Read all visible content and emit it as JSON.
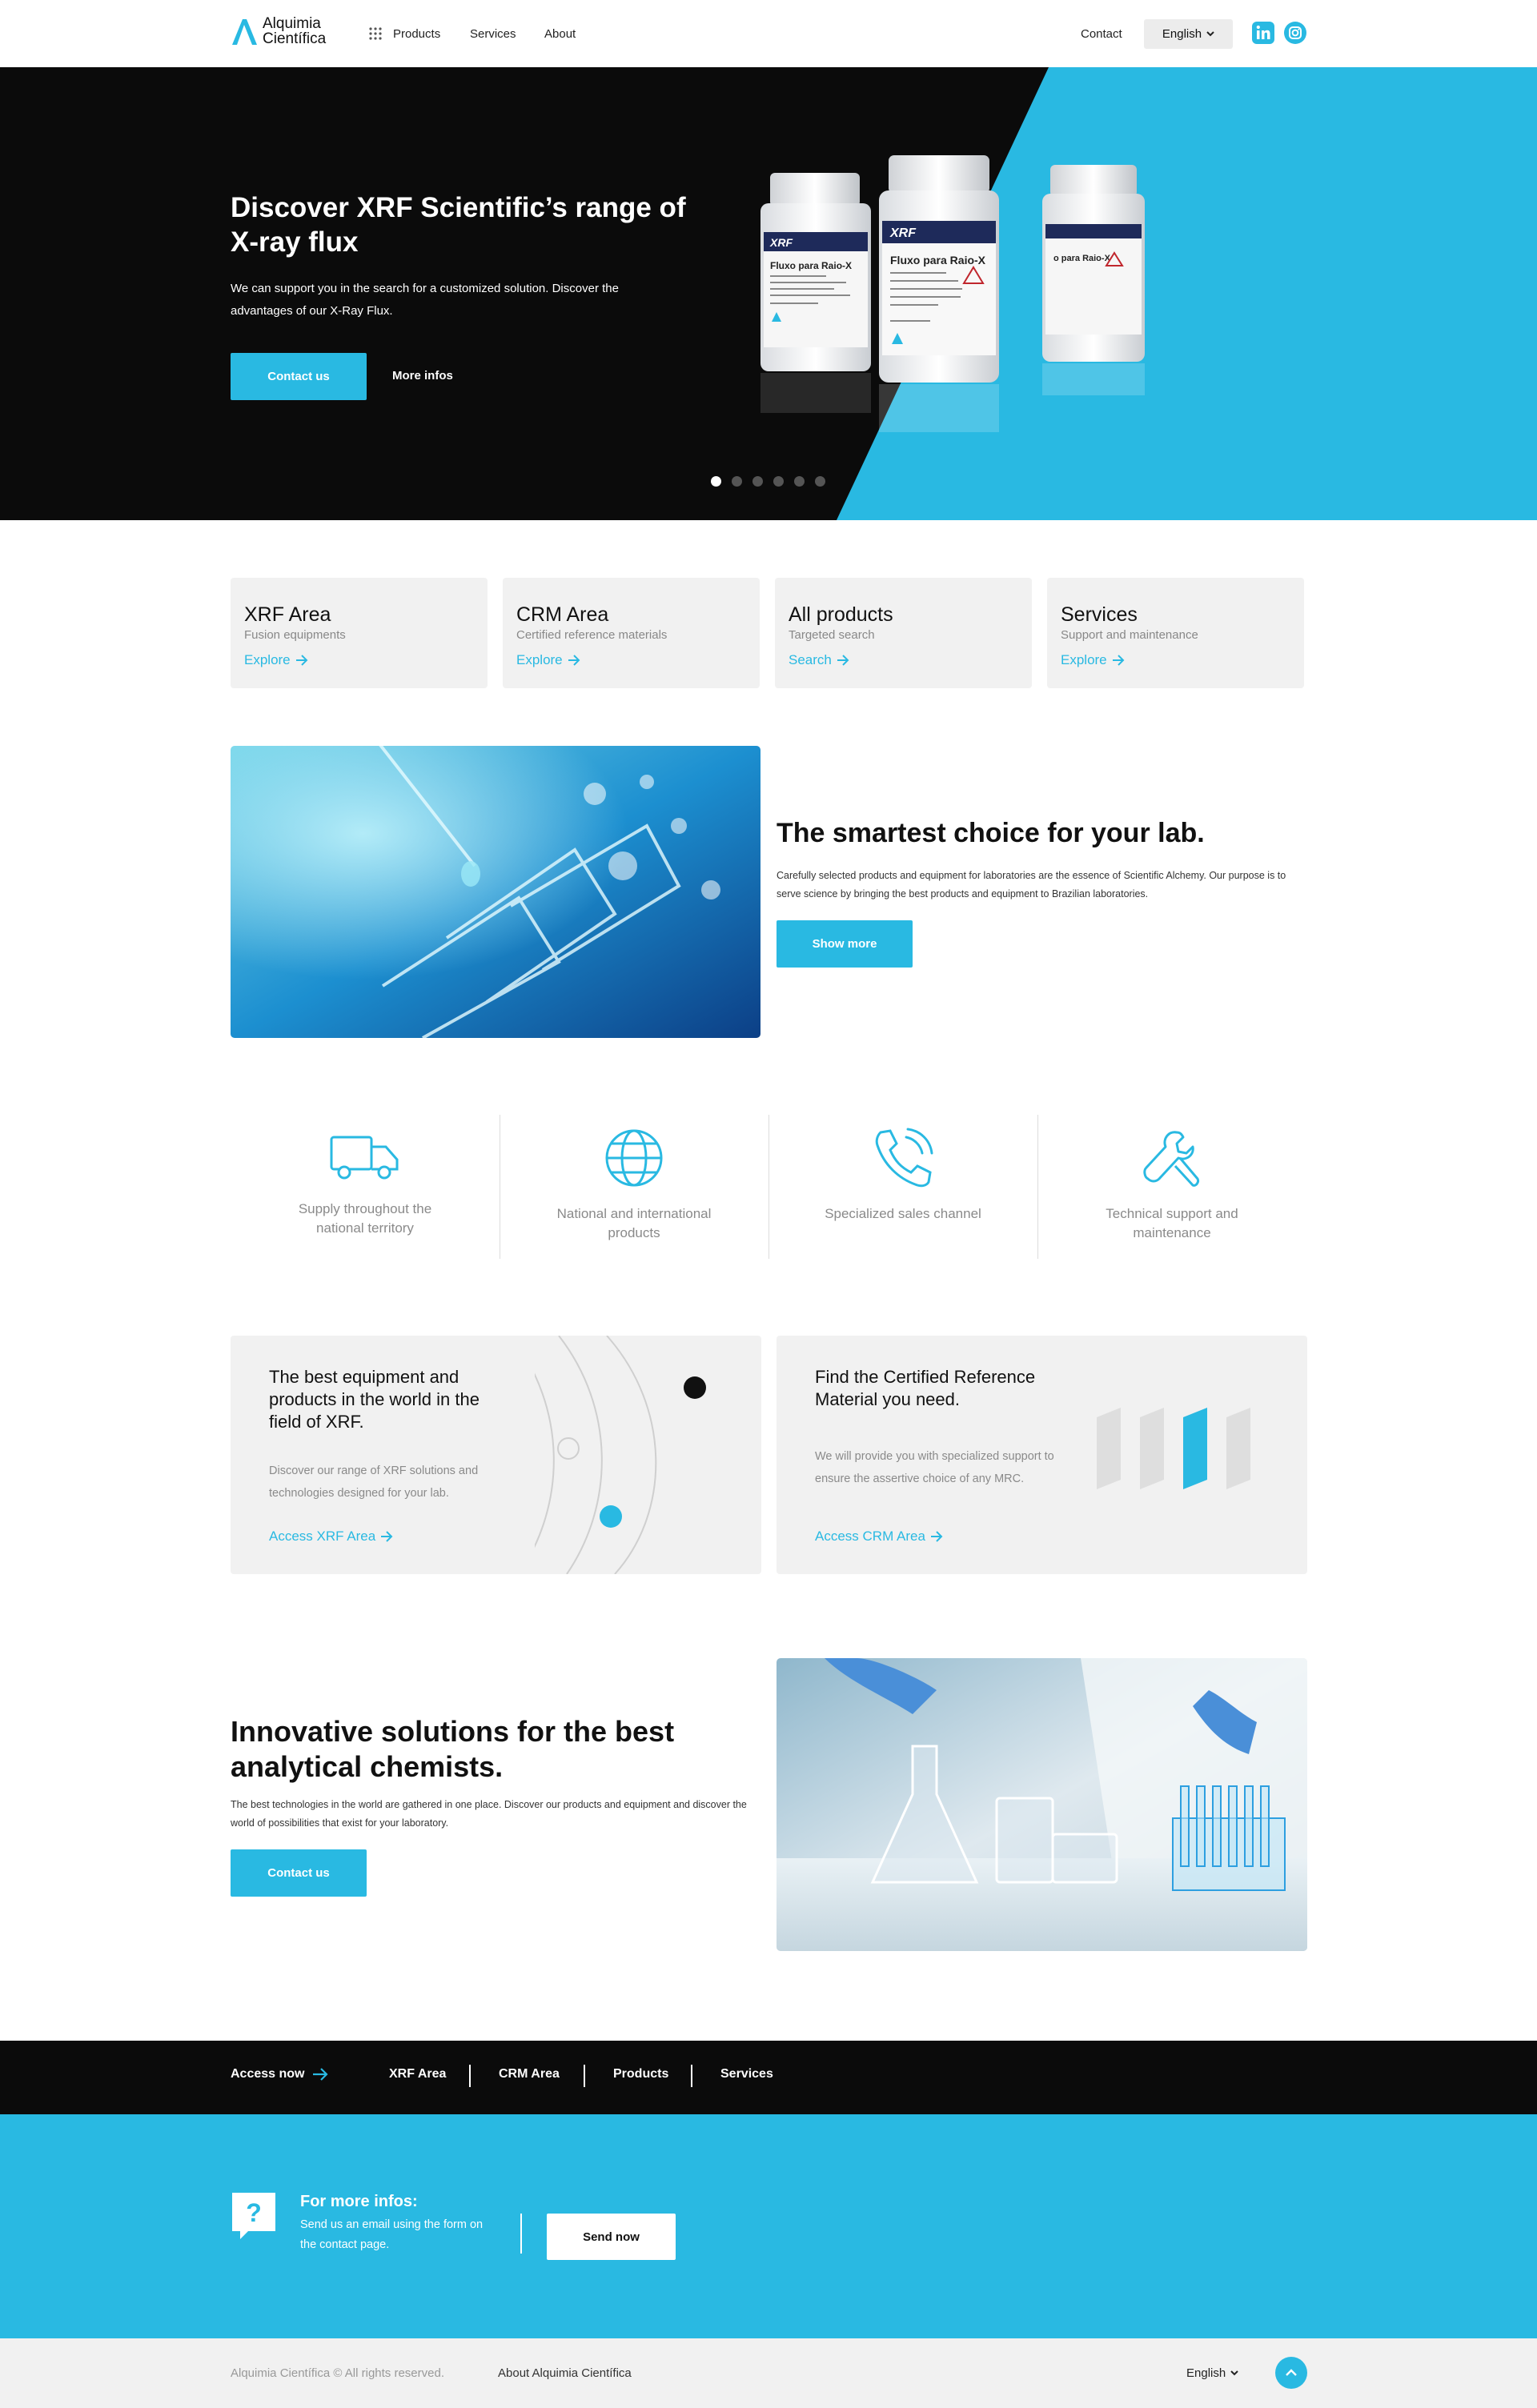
{
  "header": {
    "logo": {
      "line1": "Alquimia",
      "line2": "Científica"
    },
    "nav": [
      "Products",
      "Services",
      "About"
    ],
    "contact": "Contact",
    "language": "English",
    "social": [
      "linkedin-icon",
      "instagram-icon"
    ]
  },
  "hero": {
    "title": "Discover XRF Scientific’s range of X-ray flux",
    "description": "We can support you in the search for a customized solution. Discover the advantages of our X-Ray Flux.",
    "cta": "Contact us",
    "more": "More infos",
    "slides": 6,
    "active_slide": 1,
    "product": {
      "brand": "XRF",
      "label": "Fluxo para Raio-X"
    }
  },
  "cards": [
    {
      "title": "XRF Area",
      "subtitle": "Fusion equipments",
      "link": "Explore"
    },
    {
      "title": "CRM Area",
      "subtitle": "Certified reference materials",
      "link": "Explore"
    },
    {
      "title": "All products",
      "subtitle": "Targeted search",
      "link": "Search"
    },
    {
      "title": "Services",
      "subtitle": "Support and maintenance",
      "link": "Explore"
    }
  ],
  "lab": {
    "title": "The smartest choice for your lab.",
    "description": "Carefully selected products and equipment for laboratories are the essence of Scientific Alchemy. Our purpose is to serve science by bringing the best products and equipment to Brazilian laboratories.",
    "button": "Show more"
  },
  "features": [
    {
      "icon": "truck-icon",
      "text": "Supply throughout the national territory"
    },
    {
      "icon": "globe-icon",
      "text": "National and international products"
    },
    {
      "icon": "phone-icon",
      "text": "Specialized sales channel"
    },
    {
      "icon": "wrench-icon",
      "text": "Technical support and maintenance"
    }
  ],
  "promos": [
    {
      "title": "The best equipment and products in the world in the field of XRF.",
      "description": "Discover our range of XRF solutions and technologies designed for your lab.",
      "link": "Access XRF Area"
    },
    {
      "title": "Find the Certified Reference Material you need.",
      "description": "We will provide you with specialized support to ensure the assertive choice of any MRC.",
      "link": "Access CRM Area"
    }
  ],
  "innovative": {
    "title": "Innovative solutions for the best analytical chemists.",
    "description": "The best technologies in the world are gathered in one place. Discover our products and equipment and discover the world of possibilities that exist for your laboratory.",
    "button": "Contact us"
  },
  "access_bar": {
    "label": "Access now",
    "links": [
      "XRF Area",
      "CRM Area",
      "Products",
      "Services"
    ]
  },
  "info": {
    "title": "For more infos:",
    "description": "Send us an email using the form on the contact page.",
    "button": "Send now"
  },
  "footer": {
    "copyright": "Alquimia Científica © All rights reserved.",
    "about": "About Alquimia Científica",
    "language": "English"
  },
  "colors": {
    "accent": "#29b9e2",
    "dark": "#0b0b0b",
    "card": "#f1f1f1"
  }
}
